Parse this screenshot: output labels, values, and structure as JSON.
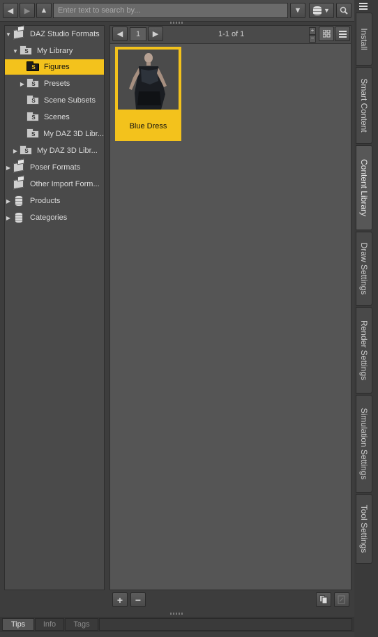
{
  "toolbar": {
    "back_icon": "arrow-left",
    "forward_icon": "arrow-right",
    "up_icon": "arrow-up",
    "search_placeholder": "Enter text to search by...",
    "filter_icon": "chevron-down",
    "database_icon": "database",
    "search_icon": "magnifier"
  },
  "tree": {
    "items": [
      {
        "label": "DAZ Studio Formats",
        "expanded": true
      },
      {
        "label": "My Library",
        "expanded": true
      },
      {
        "label": "Figures",
        "selected": true
      },
      {
        "label": "Presets",
        "expanded": false
      },
      {
        "label": "Scene Subsets"
      },
      {
        "label": "Scenes"
      },
      {
        "label": "My DAZ 3D Libr..."
      },
      {
        "label": "My DAZ 3D Libr...",
        "expanded": false
      },
      {
        "label": "Poser Formats",
        "expanded": false
      },
      {
        "label": "Other Import Form..."
      },
      {
        "label": "Products",
        "expanded": false
      },
      {
        "label": "Categories",
        "expanded": false
      }
    ]
  },
  "content": {
    "page": "1",
    "count_text": "1-1 of 1",
    "view_mode": "icons",
    "items": [
      {
        "label": "Blue Dress",
        "selected": true
      }
    ]
  },
  "bottom_tabs": [
    {
      "label": "Tips",
      "active": true
    },
    {
      "label": "Info",
      "active": false
    },
    {
      "label": "Tags",
      "active": false
    }
  ],
  "side_tabs": [
    {
      "label": "Install",
      "active": false
    },
    {
      "label": "Smart Content",
      "active": false
    },
    {
      "label": "Content Library",
      "active": true
    },
    {
      "label": "Draw Settings",
      "active": false
    },
    {
      "label": "Render Settings",
      "active": false
    },
    {
      "label": "Simulation Settings",
      "active": false
    },
    {
      "label": "Tool Settings",
      "active": false
    }
  ],
  "colors": {
    "selection": "#f3c21c",
    "panel": "#4a4a4a",
    "content_bg": "#555555"
  }
}
